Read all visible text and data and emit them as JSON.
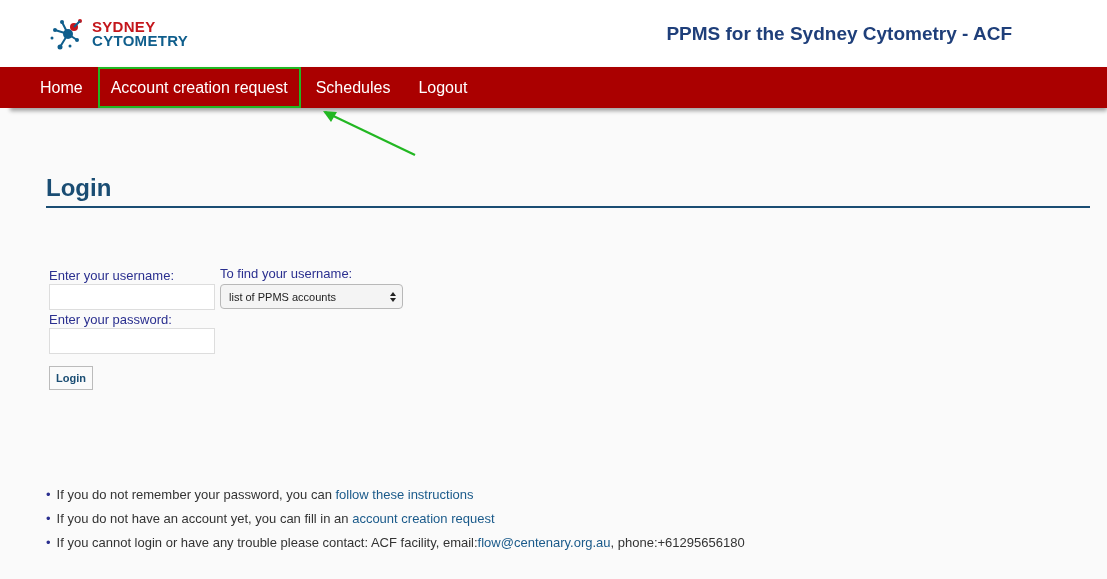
{
  "header": {
    "logo_lines": [
      "SYDNEY",
      "CYTOMETRY"
    ],
    "title": "PPMS for the Sydney Cytometry - ACF"
  },
  "nav": [
    {
      "label": "Home",
      "highlighted": false
    },
    {
      "label": "Account creation request",
      "highlighted": true
    },
    {
      "label": "Schedules",
      "highlighted": false
    },
    {
      "label": "Logout",
      "highlighted": false
    }
  ],
  "heading": "Login",
  "form": {
    "username_label": "Enter your username:",
    "find_label": "To find your username:",
    "find_select": "list of PPMS accounts",
    "password_label": "Enter your password:",
    "button": "Login"
  },
  "notes": [
    {
      "bullet": "•",
      "text": "If you do not remember your password, you can ",
      "link": "follow these instructions"
    },
    {
      "bullet": "•",
      "text": "If you do not have an account yet, you can fill in an ",
      "link": "account creation request"
    },
    {
      "bullet": "•",
      "text": "If you cannot login or have any trouble please contact: ACF facility, email:",
      "link": "flow@centenary.org.au",
      "after": ", phone:+61295656180"
    }
  ]
}
